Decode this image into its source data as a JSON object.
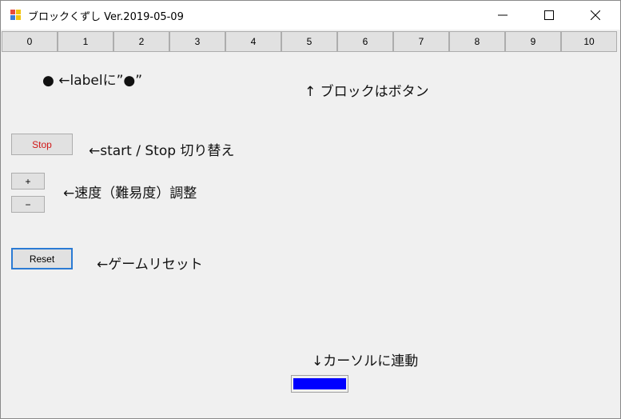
{
  "window": {
    "title": "ブロックくずし Ver.2019-05-09",
    "icon": "app-blocks-icon",
    "controls": [
      "minimize-icon",
      "maximize-icon",
      "close-icon"
    ]
  },
  "blocks": [
    "0",
    "1",
    "2",
    "3",
    "4",
    "5",
    "6",
    "7",
    "8",
    "9",
    "10"
  ],
  "annotations": {
    "ball": "● ←labelに”●”",
    "blocks_note": "↑ ブロックはボタン",
    "stop_note": "←start / Stop 切り替え",
    "speed_note": "←速度（難易度）調整",
    "reset_note": "←ゲームリセット",
    "paddle_note": "↓カーソルに連動"
  },
  "buttons": {
    "stop": "Stop",
    "plus": "+",
    "minus": "−",
    "reset": "Reset"
  },
  "colors": {
    "stop_text": "#d01818",
    "paddle": "#0000ff",
    "reset_focus_border": "#2b7bd4"
  }
}
